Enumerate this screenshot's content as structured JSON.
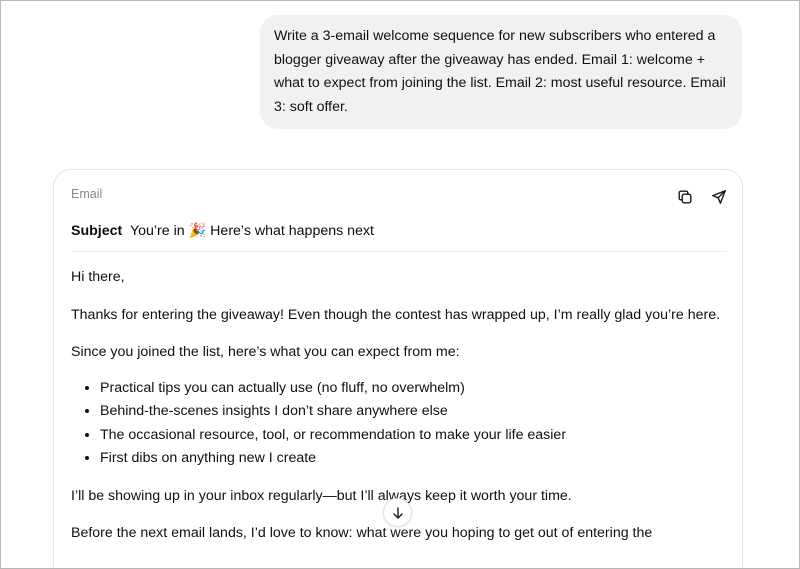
{
  "user_message": {
    "text": "Write a 3-email welcome sequence for new subscribers who entered a blogger giveaway after the giveaway has ended. Email 1: welcome + what to expect from joining the list. Email 2: most useful resource. Email 3: soft offer."
  },
  "email_card": {
    "label": "Email",
    "copy_icon": "copy-icon",
    "send_icon": "send-icon",
    "subject_label": "Subject",
    "subject_value": "You’re in 🎉 Here’s what happens next",
    "greeting": "Hi there,",
    "para1": "Thanks for entering the giveaway! Even though the contest has wrapped up, I’m really glad you’re here.",
    "para2": "Since you joined the list, here’s what you can expect from me:",
    "bullets": [
      "Practical tips you can actually use (no fluff, no overwhelm)",
      "Behind-the-scenes insights I don’t share anywhere else",
      "The occasional resource, tool, or recommendation to make your life easier",
      "First dibs on anything new I create"
    ],
    "para3": "I’ll be showing up in your inbox regularly—but I’ll always keep it worth your time.",
    "para4": "Before the next email lands, I’d love to know: what were you hoping to get out of entering the"
  },
  "scroll_down_icon": "arrow-down-icon"
}
